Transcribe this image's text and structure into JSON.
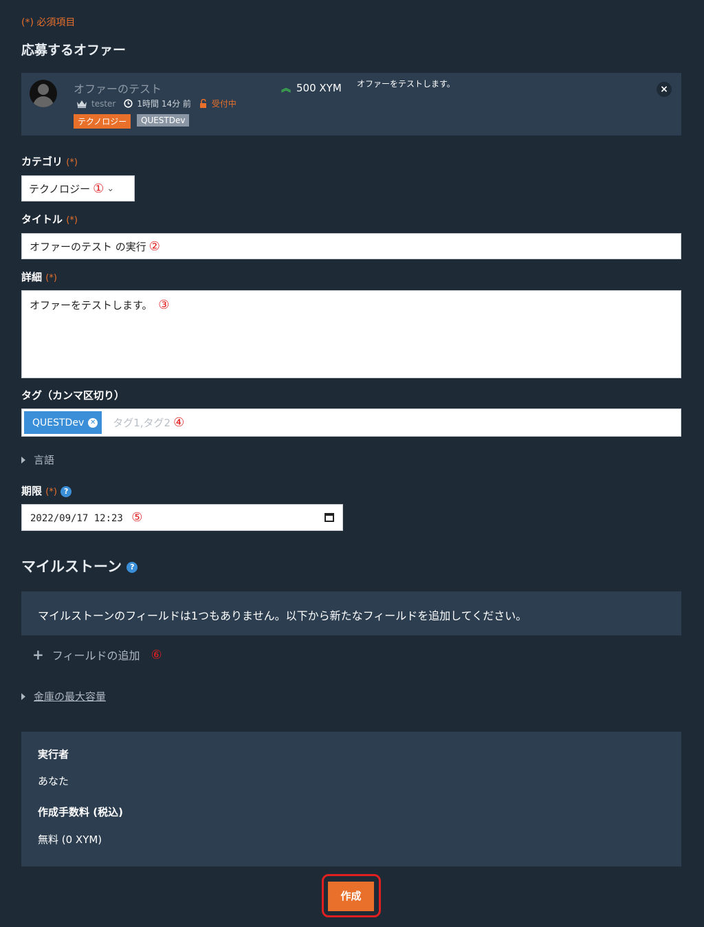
{
  "required_note": "(*) 必須項目",
  "offer_heading": "応募するオファー",
  "offer": {
    "title": "オファーのテスト",
    "user": "tester",
    "time": "1時間 14分 前",
    "status": "受付中",
    "reward": "500 XYM",
    "description": "オファーをテストします。",
    "category_tag": "テクノロジー",
    "tag": "QUESTDev",
    "close": "×"
  },
  "req_mark": "(*)",
  "fields": {
    "category_label": "カテゴリ",
    "category_value": "テクノロジー",
    "title_label": "タイトル",
    "title_value": "オファーのテスト の実行",
    "detail_label": "詳細",
    "detail_value": "オファーをテストします。",
    "tags_label": "タグ（カンマ区切り）",
    "tags_chip": "QUESTDev",
    "tags_placeholder": "タグ1,タグ2",
    "language_label": "言語",
    "deadline_label": "期限",
    "deadline_value": "2022/09/17 12:23"
  },
  "annotations": [
    "①",
    "②",
    "③",
    "④",
    "⑤",
    "⑥"
  ],
  "milestone": {
    "heading": "マイルストーン",
    "empty_message": "マイルストーンのフィールドは1つもありません。以下から新たなフィールドを追加してください。",
    "add_field": "フィールドの追加"
  },
  "vault_label": "金庫の最大容量",
  "summary": {
    "executor_label": "実行者",
    "executor_value": "あなた",
    "fee_label": "作成手数料 (税込)",
    "fee_value": "無料 (0 XYM)"
  },
  "submit_label": "作成",
  "colors": {
    "accent": "#e8702a",
    "background": "#1f2a37",
    "panel": "#2c3e50",
    "link_blue": "#3a8fd8",
    "annotation_red": "#e02020"
  }
}
